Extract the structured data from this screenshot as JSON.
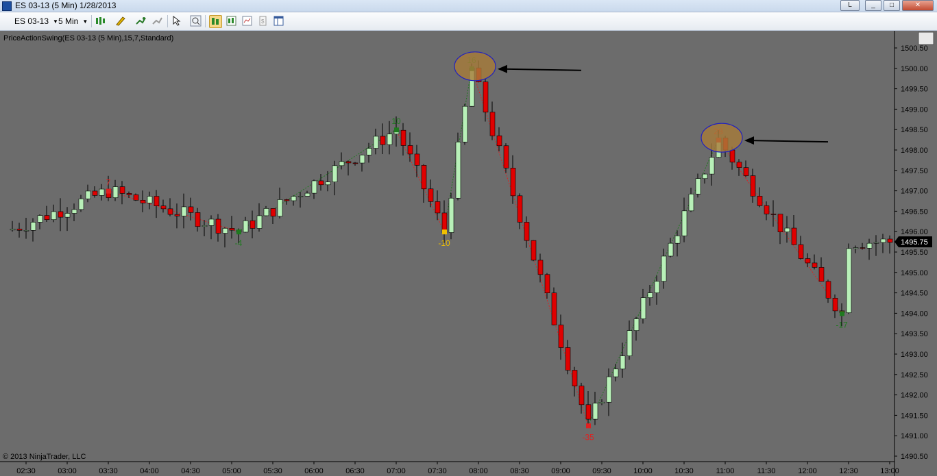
{
  "window": {
    "title": "ES 03-13 (5 Min)  1/28/2013",
    "dropdown_label": "L"
  },
  "toolbar": {
    "instrument": "ES 03-13",
    "interval": "5 Min"
  },
  "chart": {
    "indicator_label": "PriceActionSwing(ES 03-13 (5 Min),15,7,Standard)",
    "copyright": "© 2013 NinjaTrader, LLC",
    "last_price_label": "1495.75",
    "colors": {
      "background": "#6c6c6c",
      "up": "#b8f0b8",
      "down": "#e00000",
      "swing_up": "#1f7a1f",
      "swing_down": "#e02020",
      "annotation_fill": "#a87c3a",
      "annotation_ring": "#2020c0"
    }
  },
  "chart_data": {
    "type": "candlestick",
    "title": "",
    "y_ticks": [
      "1490.50",
      "1491.00",
      "1491.50",
      "1492.00",
      "1492.50",
      "1493.00",
      "1493.50",
      "1494.00",
      "1494.50",
      "1495.00",
      "1495.50",
      "1496.00",
      "1496.50",
      "1497.00",
      "1497.50",
      "1498.00",
      "1498.50",
      "1499.00",
      "1499.50",
      "1500.00",
      "1500.50"
    ],
    "x_ticks": [
      "02:30",
      "03:00",
      "03:30",
      "04:00",
      "04:30",
      "05:00",
      "05:30",
      "06:00",
      "06:30",
      "07:00",
      "07:30",
      "08:00",
      "08:30",
      "09:00",
      "09:30",
      "10:00",
      "10:30",
      "11:00",
      "11:30",
      "12:00",
      "12:30",
      "13:00"
    ],
    "ylim": [
      1490.5,
      1500.5
    ],
    "swing_points": [
      {
        "time": "03:30",
        "price": 1497.0,
        "label": "7",
        "color": "#e02020"
      },
      {
        "time": "05:05",
        "price": 1496.0,
        "label": "-4",
        "color": "#1f7a1f"
      },
      {
        "time": "07:00",
        "price": 1498.5,
        "label": "10",
        "color": "#1f7a1f"
      },
      {
        "time": "07:35",
        "price": 1496.0,
        "label": "-10",
        "color": "#f0c000"
      },
      {
        "time": "07:55",
        "price": 1500.0,
        "label": "16",
        "color": "#1f7a1f"
      },
      {
        "time": "09:20",
        "price": 1491.25,
        "label": "-35",
        "color": "#e02020"
      },
      {
        "time": "10:55",
        "price": 1498.25,
        "label": "28",
        "color": "#e02020"
      },
      {
        "time": "12:25",
        "price": 1494.0,
        "label": "-17",
        "color": "#1f7a1f"
      }
    ],
    "annotations": [
      {
        "type": "ellipse-arrow",
        "target": "16"
      },
      {
        "type": "ellipse-arrow",
        "target": "28"
      }
    ]
  }
}
